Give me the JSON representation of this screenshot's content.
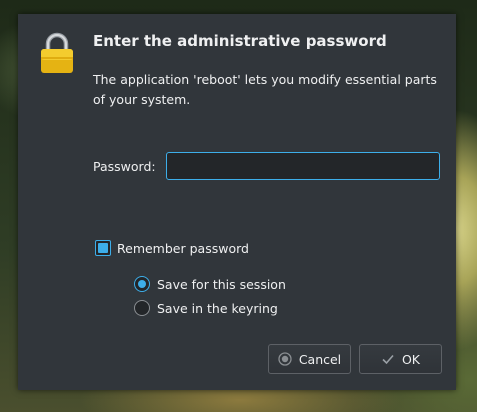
{
  "dialog": {
    "title": "Enter the administrative password",
    "description": "The application 'reboot' lets you modify essential parts of your system.",
    "password_label": "Password:",
    "password_value": "",
    "remember_label": "Remember password",
    "remember_checked": true,
    "options": [
      {
        "label": "Save for this session",
        "selected": true
      },
      {
        "label": "Save in the keyring",
        "selected": false
      }
    ],
    "cancel_label": "Cancel",
    "ok_label": "OK",
    "icons": {
      "header": "lock-icon",
      "cancel": "cancel-icon",
      "ok": "checkmark-icon"
    },
    "colors": {
      "accent": "#3daee9",
      "lock_body": "#f0c419",
      "window_bg": "#31363b"
    }
  }
}
